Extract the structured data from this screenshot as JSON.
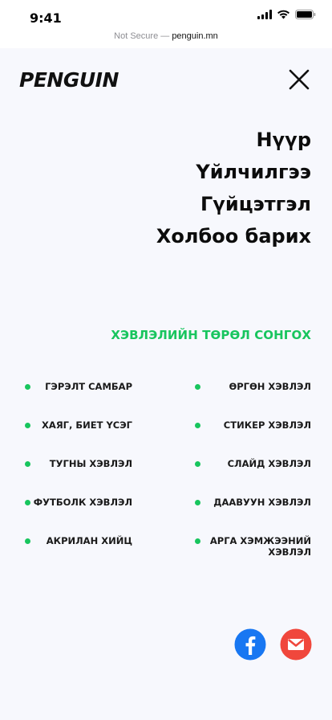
{
  "status_bar": {
    "time": "9:41"
  },
  "address_bar": {
    "prefix": "Not Secure — ",
    "domain": "penguin.mn"
  },
  "header": {
    "logo_text": "PENGUIN"
  },
  "nav": {
    "items": [
      {
        "label": "Нүүр"
      },
      {
        "label": "Үйлчилгээ"
      },
      {
        "label": "Гүйцэтгэл"
      },
      {
        "label": "Холбоо барих"
      }
    ]
  },
  "print_types": {
    "title": "ХЭВЛЭЛИЙН ТӨРӨЛ СОНГОХ",
    "left": [
      {
        "label": "ГЭРЭЛТ САМБАР"
      },
      {
        "label": "ХАЯГ, БИЕТ ҮСЭГ"
      },
      {
        "label": "ТУГНЫ ХЭВЛЭЛ"
      },
      {
        "label": "ФУТБОЛК ХЭВЛЭЛ"
      },
      {
        "label": "АКРИЛАН ХИЙЦ"
      }
    ],
    "right": [
      {
        "label": "ӨРГӨН ХЭВЛЭЛ"
      },
      {
        "label": "СТИКЕР ХЭВЛЭЛ"
      },
      {
        "label": "СЛАЙД ХЭВЛЭЛ"
      },
      {
        "label": "ДААВУУН ХЭВЛЭЛ"
      },
      {
        "label": "АРГА ХЭМЖЭЭНИЙ ХЭВЛЭЛ"
      }
    ],
    "bullet_color": "#18c55e"
  },
  "social": {
    "facebook_icon": "facebook-icon",
    "mail_icon": "mail-icon",
    "facebook_color": "#1877f2",
    "mail_color": "#f0473c"
  }
}
